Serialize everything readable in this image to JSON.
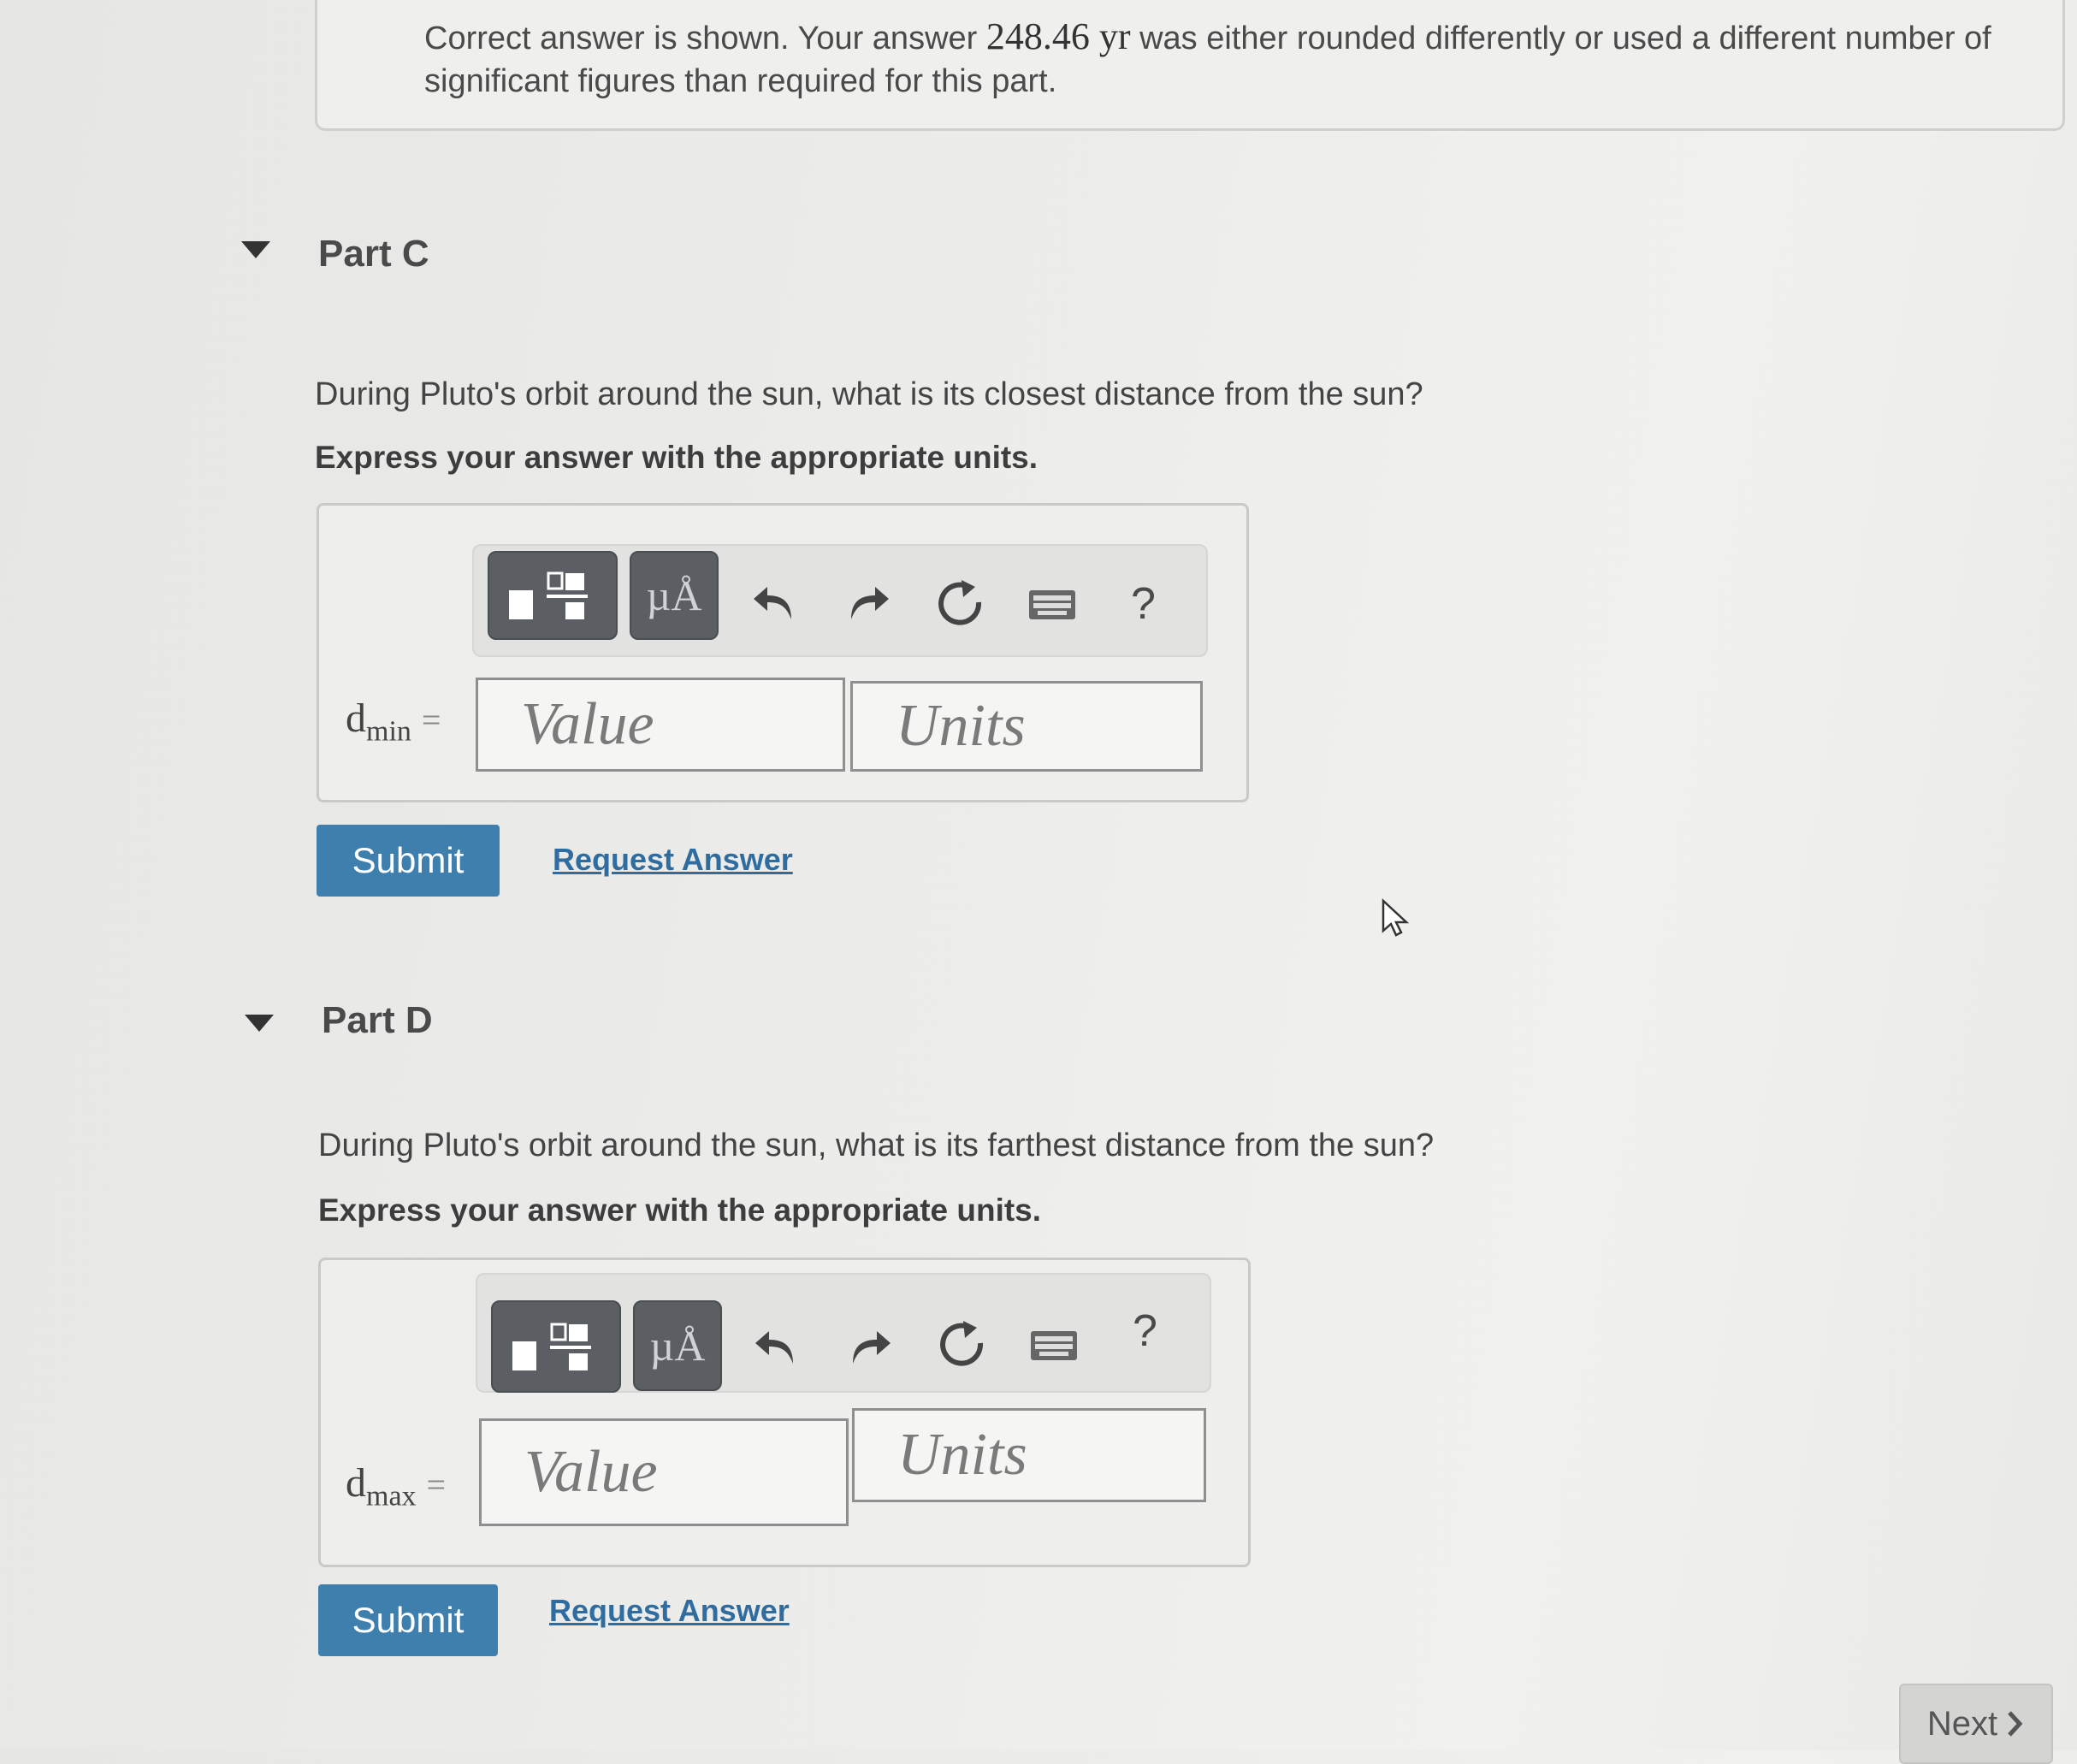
{
  "feedback": {
    "text_before": "Correct answer is shown. Your answer ",
    "answer_value": "248.46 yr",
    "text_after": " was either rounded differently or used a different number of significant figures than required for this part."
  },
  "part_c": {
    "title": "Part C",
    "question": "During Pluto's orbit around the sun, what is its closest distance from the sun?",
    "instruction": "Express your answer with the appropriate units.",
    "var_symbol": "d",
    "var_sub": "min",
    "equals": "=",
    "value_placeholder": "Value",
    "units_placeholder": "Units",
    "submit_label": "Submit",
    "request_label": "Request Answer"
  },
  "part_d": {
    "title": "Part D",
    "question": "During Pluto's orbit around the sun, what is its farthest distance from the sun?",
    "instruction": "Express your answer with the appropriate units.",
    "var_symbol": "d",
    "var_sub": "max",
    "equals": "=",
    "value_placeholder": "Value",
    "units_placeholder": "Units",
    "submit_label": "Submit",
    "request_label": "Request Answer"
  },
  "toolbar": {
    "units_glyph": "µÅ",
    "help_label": "?",
    "icons": [
      "templates-icon",
      "units-icon",
      "undo-icon",
      "redo-icon",
      "reset-icon",
      "keyboard-icon",
      "help-icon"
    ]
  },
  "next_label": "Next",
  "colors": {
    "submit": "#3f7fae",
    "link": "#2f6da0",
    "tool_dark": "#5b5e63"
  }
}
